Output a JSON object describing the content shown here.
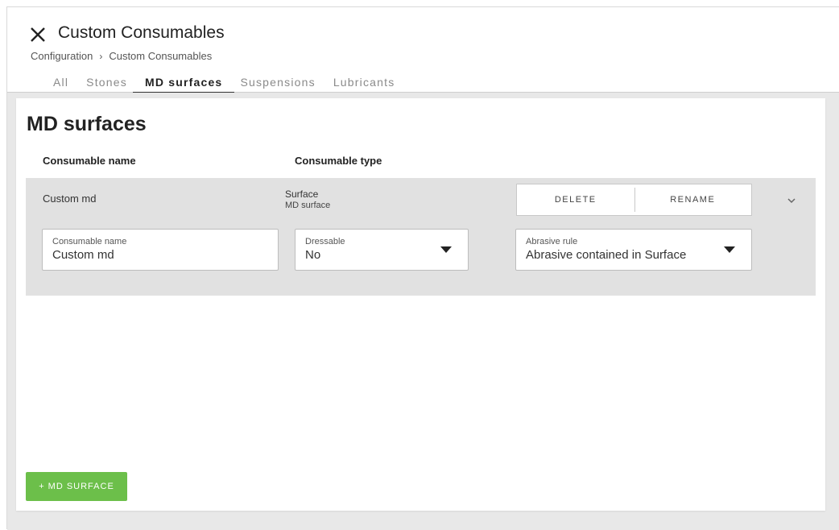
{
  "header": {
    "title": "Custom Consumables",
    "breadcrumb": {
      "parent": "Configuration",
      "separator": "›",
      "current": "Custom Consumables"
    },
    "tabs": [
      {
        "label": "All",
        "active": false
      },
      {
        "label": "Stones",
        "active": false
      },
      {
        "label": "MD surfaces",
        "active": true
      },
      {
        "label": "Suspensions",
        "active": false
      },
      {
        "label": "Lubricants",
        "active": false
      }
    ]
  },
  "section": {
    "title": "MD surfaces",
    "columns": {
      "name": "Consumable name",
      "type": "Consumable type"
    }
  },
  "row": {
    "name": "Custom md",
    "type": "Surface",
    "subtype": "MD surface",
    "delete_label": "DELETE",
    "rename_label": "RENAME",
    "fields": {
      "name": {
        "label": "Consumable name",
        "value": "Custom md"
      },
      "dressable": {
        "label": "Dressable",
        "value": "No"
      },
      "abrasive": {
        "label": "Abrasive rule",
        "value": "Abrasive contained in Surface"
      }
    }
  },
  "add_button_label": "+ MD SURFACE",
  "colors": {
    "accent_green": "#6cbf4a",
    "row_bg": "#e1e1e1",
    "page_bg": "#e8e8e8"
  },
  "icons": {
    "close": "close-icon",
    "expand": "chevron-down-icon",
    "dropdown": "caret-down-icon"
  }
}
